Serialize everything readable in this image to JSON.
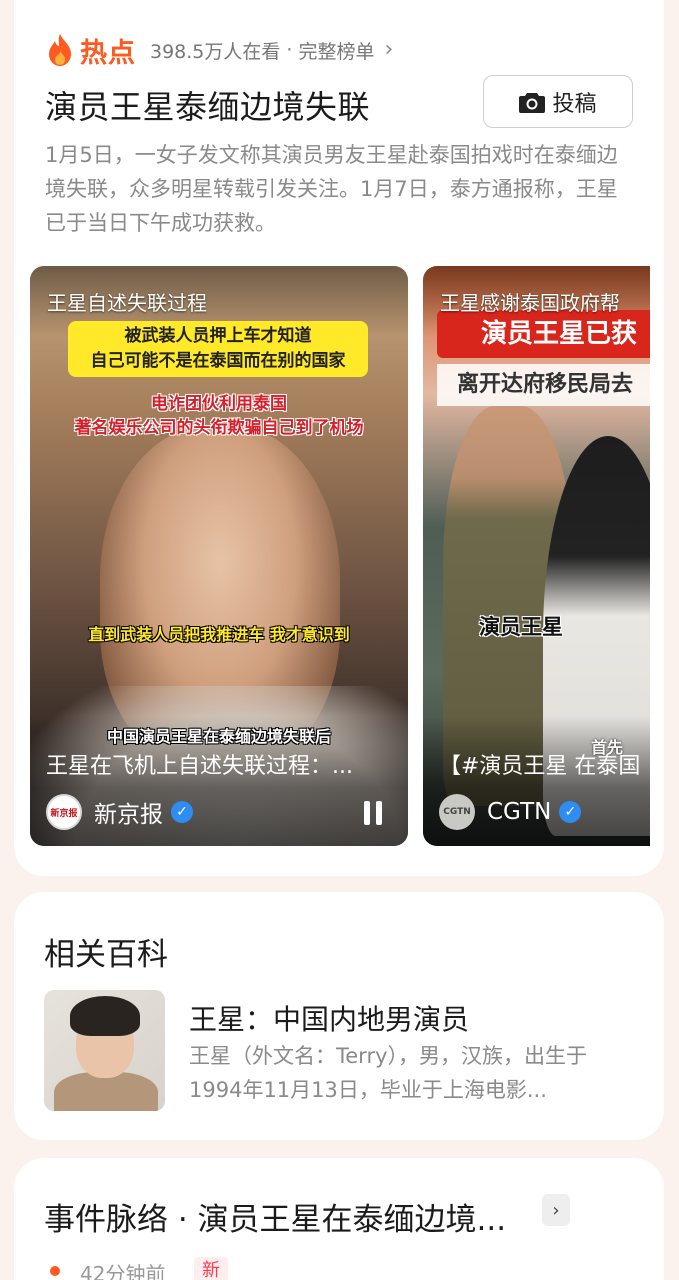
{
  "hot": {
    "label": "热点",
    "viewers": "398.5万人在看",
    "separator": "·",
    "full_list": "完整榜单",
    "topic_title": "演员王星泰缅边境失联",
    "submit_label": "投稿",
    "summary": "1月5日，一女子发文称其演员男友王星赴泰国拍戏时在泰缅边境失联，众多明星转载引发关注。1月7日，泰方通报称，王星已于当日下午成功获救。"
  },
  "videos": [
    {
      "top_caption": "王星自述失联过程",
      "sub_yellow": "被武装人员押上车才知道\n自己可能不是在泰国而在别的国家",
      "sub_red": "电诈团伙利用泰国\n著名娱乐公司的头衔欺骗自己到了机场",
      "sub_mid": "直到武装人员把我推进车 我才意识到",
      "sub_low": "中国演员王星在泰缅边境失联后",
      "bottom_caption": "王星在飞机上自述失联过程：...",
      "source": "新京报",
      "source_logo_text": "新京报"
    },
    {
      "top_caption": "王星感谢泰国政府帮",
      "banner": "演员王星已获",
      "banner2": "离开达府移民局去",
      "label": "演员王星",
      "corner": "首先",
      "bottom_caption": "【#演员王星 在泰国",
      "source": "CGTN",
      "source_logo_text": "CGTN"
    }
  ],
  "baike": {
    "heading": "相关百科",
    "name": "王星：中国内地男演员",
    "desc": "王星（外文名：Terry），男，汉族，出生于1994年11月13日，毕业于上海电影..."
  },
  "timeline": {
    "heading": "事件脉络 · 演员王星在泰缅边境...",
    "time": "42分钟前",
    "badge": "新"
  },
  "icons": {
    "flame": "flame-icon",
    "camera": "camera-icon",
    "verified": "verified-icon",
    "pause": "pause-icon",
    "chevron": "chevron-right-icon"
  },
  "colors": {
    "accent": "#ff5a1f",
    "verified": "#2f8cf0",
    "badge": "#ff3b4f",
    "background": "#fbf1ed"
  }
}
